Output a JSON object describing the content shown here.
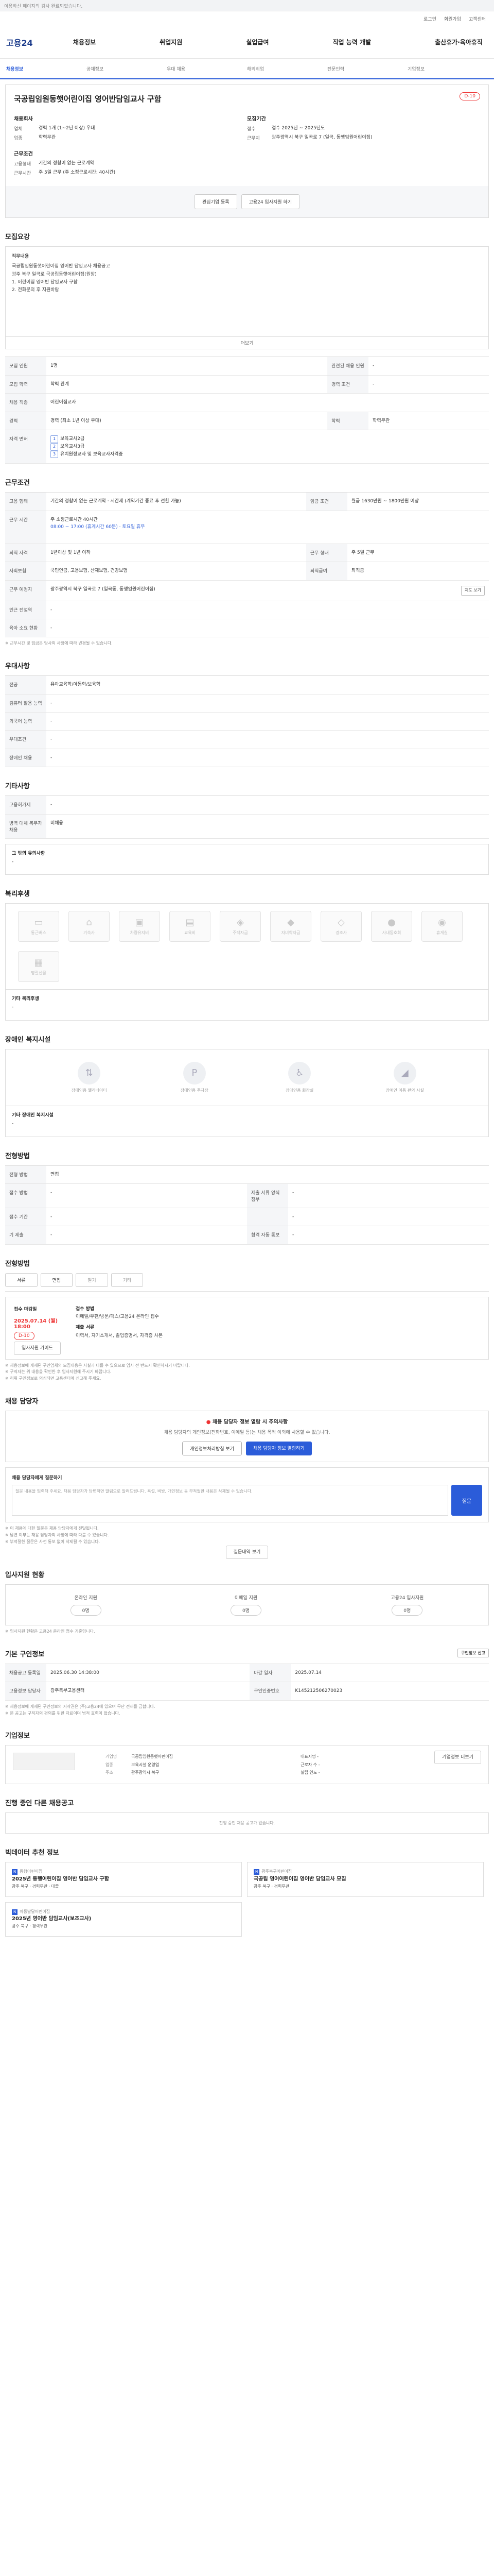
{
  "topbar": {
    "notice": "이용하신 페이지의 검사 완료되었습니다."
  },
  "util": [
    "로그인",
    "회원가입",
    "고객센터"
  ],
  "logo": "고용24",
  "gnb": [
    "채용정보",
    "취업지원",
    "실업급여",
    "직업 능력 개발",
    "출산휴가·육아휴직"
  ],
  "subnav": [
    "채용정보",
    "공채정보",
    "우대 채용",
    "해외취업",
    "전문인력",
    "기업정보"
  ],
  "job": {
    "title": "국공립임원동햇어린이집 영어반담임교사 구함",
    "dday": "D-10",
    "company_label": "채용회사",
    "rows_left": [
      {
        "k": "업체",
        "v": "경력 1개 (1~2년 이상) 우대"
      },
      {
        "k": "업종",
        "v": "학력무관"
      }
    ],
    "cond_label": "근무조건",
    "rows_left2": [
      {
        "k": "고용형태",
        "v": "기간의 정함이 없는 근로계약"
      },
      {
        "k": "근무시간",
        "v": "주 5일 근무 (주 소정근로시간: 40시간)"
      }
    ],
    "period_label": "모집기간",
    "rows_right": [
      {
        "k": "접수",
        "v": "접수 2025년 ~ 2025년도"
      },
      {
        "k": "근무지",
        "v": "광주광역시 북구 일곡로 7 (일곡, 동행임원어린이집)"
      }
    ],
    "btn_interest": "관심기업 등록",
    "btn_apply": "고용24 입사지원 하기"
  },
  "recruit": {
    "title": "모집요강",
    "box_label": "직무내용",
    "lines": [
      "국공립임원동햇어린이집 영어반 담임교사 채용공고",
      "",
      "광주 북구 일곡로 국공립동햇어린이집(원장)",
      "1. 어린이집 영어반 담임교사 구함",
      "2. 전화문의 후 지원바람"
    ],
    "more": "더보기",
    "table": [
      {
        "k": "모집 인원",
        "v": "1명",
        "k2": "관련된 채용 인원",
        "v2": "-"
      },
      {
        "k": "모집 학력",
        "v": "학력 관계",
        "k2": "경력 조건",
        "v2": "-"
      },
      {
        "k": "채용 직종",
        "v": "어린이집교사",
        "k2": "",
        "v2": ""
      },
      {
        "k": "경력",
        "v": "경력 (최소 1년 이상 우대)",
        "k2": "학력",
        "v2": "학력무관"
      }
    ],
    "license_k": "자격 면허",
    "license": [
      "보육교사2급",
      "보육교사3급",
      "유치원정교사 및 보육교사자격증"
    ]
  },
  "conditions": {
    "title": "근무조건",
    "rows": [
      {
        "k": "고용 형태",
        "v": "기간의 정함이 없는 근로계약 · 시간제 (계약기간 종료 후 전환 가능)",
        "k2": "임금 조건",
        "v2": "월급 1630만원 ~ 1800만원 이상"
      },
      {
        "k": "근무 시간",
        "v": "주 소정근로시간 40시간",
        "k2": "",
        "v2": ""
      },
      {
        "k": "",
        "v": "08:00 ~ 17:00 (휴게시간 60분) · 토요일 휴무",
        "k2": "",
        "v2": ""
      },
      {
        "k": "퇴직 자격",
        "v": "1년이상 및 1년 이하",
        "k2": "근무 형태",
        "v2": "주 5일 근무"
      },
      {
        "k": "사회보험",
        "v": "국민연금, 고용보험, 산재보험, 건강보험",
        "k2": "퇴직급여",
        "v2": "퇴직금"
      },
      {
        "k": "근무 예정지",
        "v": "광주광역시 북구 일곡로 7 (일곡동, 동행임원어린이집)",
        "k2": "",
        "v2": ""
      },
      {
        "k": "인근 전철역",
        "v": "-",
        "k2": "",
        "v2": ""
      },
      {
        "k": "육아 소요 현황",
        "v": "-",
        "k2": "",
        "v2": ""
      }
    ],
    "map_btn": "지도 보기",
    "note": "※ 근무시간 및 임금은 당사의 사정에 따라 변경될 수 있습니다."
  },
  "prefer": {
    "title": "우대사항",
    "rows": [
      {
        "k": "전공",
        "v": "유아교육학/아동학/보육학"
      },
      {
        "k": "컴퓨터 활용 능력",
        "v": "-"
      },
      {
        "k": "외국어 능력",
        "v": "-"
      },
      {
        "k": "우대조건",
        "v": "-"
      },
      {
        "k": "장애인 채용",
        "v": "-"
      }
    ]
  },
  "etc": {
    "title": "기타사항",
    "rows": [
      {
        "k": "고용허가제",
        "v": "-"
      },
      {
        "k": "병역 대체 복무자 채용",
        "v": "미채용"
      }
    ],
    "etc_k": "그 밖의 유의사항",
    "etc_v": "-"
  },
  "welfare": {
    "title": "복리후생",
    "items": [
      "통근버스",
      "기숙사",
      "차량유지비",
      "교육비",
      "주택자금",
      "자녀학자금",
      "경조사",
      "사내동호회",
      "휴게실",
      "명절선물"
    ],
    "sub_title": "기타 복리후생",
    "sub_value": "-"
  },
  "disabled": {
    "title": "장애인 복지시설",
    "items": [
      "장애인용 엘리베이터",
      "장애인용 주차장",
      "장애인용 화장실",
      "장애인 이동 편의 시설"
    ],
    "sub_title": "기타 장애인 복지시설",
    "sub_value": "-"
  },
  "process": {
    "title": "전형방법",
    "rows": [
      {
        "k": "전형 방법",
        "v": "면접",
        "k2": "",
        "v2": ""
      },
      {
        "k": "접수 방법",
        "v": "-",
        "k2": "제출 서류 양식 첨부",
        "v2": "-"
      },
      {
        "k": "접수 기간",
        "v": "-",
        "k2": "",
        "v2": "-"
      },
      {
        "k": "기 제출",
        "v": "-",
        "k2": "합격 자동 통보",
        "v2": "-"
      }
    ]
  },
  "apply": {
    "title": "전형방법",
    "tabs": [
      "서류",
      "면접",
      "필기",
      "기타"
    ],
    "deadline_label": "접수 마감일",
    "deadline": "2025.07.14 (월) 18:00",
    "dday": "D-10",
    "btn": "입사지원 가이드",
    "way_label": "접수 방법",
    "way": "이메일/우편/방문/팩스/고용24 온라인 접수",
    "docs_label": "제출 서류",
    "docs": "이력서, 자기소개서, 졸업증명서, 자격증 사본"
  },
  "warning": {
    "lines": [
      "※ 채용정보에 게재된 구인업체의 모집내용은 사실과 다를 수 있으므로 입사 전 반드시 확인하시기 바랍니다.",
      "※ 구직자는 위 내용을 확인한 후 입사지원해 주시기 바랍니다.",
      "※ 허위 구인정보로 의심되면 고용센터에 신고해 주세요."
    ]
  },
  "manager": {
    "title": "채용 담당자",
    "alert": "채용 담당자 정보 열람 시 주의사항",
    "text": "채용 담당자의 개인정보(전화번호, 이메일 등)는 채용 목적 이외에 사용할 수 없습니다.",
    "btn1": "개인정보처리방침 보기",
    "btn2": "채용 담당자 정보 열람하기",
    "q_label": "채용 담당자에게 질문하기",
    "q_placeholder": "질문 내용을 입력해 주세요. 채용 담당자가 답변하면 알림으로 알려드립니다. 욕설, 비방, 개인정보 등 부적절한 내용은 삭제될 수 있습니다.",
    "q_btn": "질문",
    "notes": [
      "※ 이 채용에 대한 질문은 채용 담당자에게 전달됩니다.",
      "※ 답변 여부는 채용 담당자의 사정에 따라 다를 수 있습니다.",
      "※ 부적절한 질문은 사전 통보 없이 삭제될 수 있습니다."
    ],
    "note_btn": "질문내역 보기"
  },
  "status": {
    "title": "입사지원 현황",
    "items": [
      {
        "label": "온라인 지원",
        "value": "0명"
      },
      {
        "label": "이메일 지원",
        "value": "0명"
      },
      {
        "label": "고용24 입사지원",
        "value": "0명"
      }
    ],
    "note": "※ 입사지원 현황은 고용24 온라인 접수 기준입니다."
  },
  "meta": {
    "title": "기본 구인정보",
    "btn": "구인정보 신고",
    "rows": [
      {
        "k": "채용공고 등록일",
        "v": "2025.06.30 14:38:00",
        "k2": "마감 일자",
        "v2": "2025.07.14"
      },
      {
        "k": "고용정보 담당자",
        "v": "광주북부고용센터",
        "k2": "구인인증번호",
        "v2": "K145212506270023"
      }
    ],
    "notes": [
      "※ 채용정보에 게재된 구인정보의 저작권은 (주)고용24에 있으며 무단 전재를 금합니다.",
      "※ 본 공고는 구직자의 편의를 위한 자료이며 법적 효력이 없습니다."
    ]
  },
  "corp": {
    "title": "기업정보",
    "rows": [
      {
        "k": "기업명",
        "v": "국공립임원동햇어린이집"
      },
      {
        "k": "업종",
        "v": "보육시설 운영업"
      },
      {
        "k": "주소",
        "v": "광주광역시 북구"
      }
    ],
    "right": [
      "대표자명 -",
      "근로자 수 -",
      "설립 연도 -"
    ],
    "btn": "기업정보 더보기"
  },
  "related": {
    "title": "진행 중인 다른 채용공고",
    "empty": "진행 중인 채용 공고가 없습니다."
  },
  "recommend": {
    "title": "빅데이터 추천 정보",
    "items": [
      {
        "co": "동행어린이집",
        "t": "2025년 동행어린이집 영어반 담임교사 구함",
        "b": "광주 북구 · 경력무관 · 대졸"
      },
      {
        "co": "광주북구어린이집",
        "t": "국공립 영어어린이집 영어반 담임교사 모집",
        "b": "광주 북구 · 경력무관"
      },
      {
        "co": "아동발달어린이집",
        "t": "2025년 영어반 담임교사(보조교사)",
        "b": "광주 북구 · 경력무관"
      }
    ]
  }
}
